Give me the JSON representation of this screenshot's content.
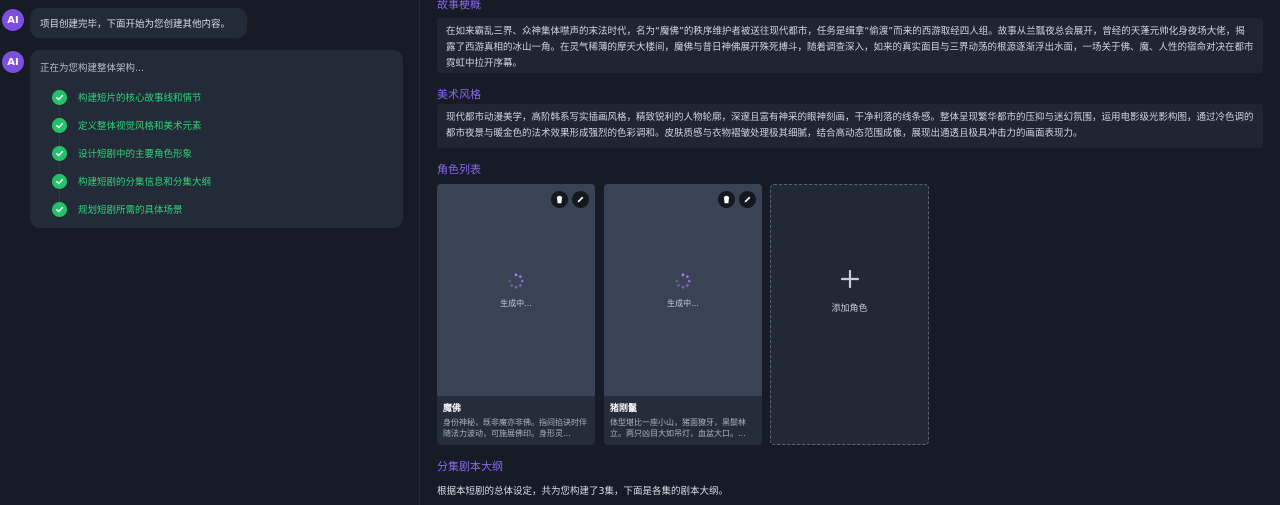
{
  "chat": {
    "avatar_label": "AI",
    "message_1": "项目创建完毕，下面开始为您创建其他内容。",
    "status_text": "正在为您构建整体架构...",
    "steps": [
      {
        "label": "构建短片的核心故事线和情节"
      },
      {
        "label": "定义整体视觉风格和美术元素"
      },
      {
        "label": "设计短剧中的主要角色形象"
      },
      {
        "label": "构建短剧的分集信息和分集大纲"
      },
      {
        "label": "规划短剧所需的具体场景"
      }
    ]
  },
  "content": {
    "story": {
      "title": "故事梗概",
      "text": "在如来霸乱三界、众神集体噤声的末法时代，名为“魔佛”的秩序维护者被送往现代都市，任务是缉拿“偷渡”而来的西游取经四人组。故事从兰瓢夜总会展开，曾经的天蓬元帅化身夜场大佬，揭露了西游真相的冰山一角。在灵气稀薄的摩天大楼间，魔佛与昔日神佛展开殊死搏斗，随着调查深入，如来的真实面目与三界动荡的根源逐渐浮出水面，一场关于佛、魔、人性的宿命对决在都市霓虹中拉开序幕。"
    },
    "art": {
      "title": "美术风格",
      "text": "现代都市动漫美学，高阶韩系写实插画风格，精致锐利的人物轮廓，深邃且富有神采的眼神刻画，干净利落的线条感。整体呈现繁华都市的压抑与迷幻氛围，运用电影级光影构图，通过冷色调的都市夜景与暖金色的法术效果形成强烈的色彩调和。皮肤质感与衣物褶皱处理极其细腻，结合高动态范围成像，展现出通透且极具冲击力的画面表现力。"
    },
    "characters": {
      "title": "角色列表",
      "generating_text": "生成中...",
      "add_label": "添加角色",
      "items": [
        {
          "name": "魔佛",
          "desc": "身份神秘，既非魔亦非佛。指间掐诀时伴随法力波动，可施展佛印。身形灵..."
        },
        {
          "name": "猪刚鬣",
          "desc": "体型堪比一座小山，猪面獠牙，黑鬃林立。两只凶目大如吊灯，血盆大口。..."
        }
      ]
    },
    "episodes": {
      "title": "分集剧本大纲",
      "text": "根据本短剧的总体设定，共为您构建了3集，下面是各集的剧本大纲。"
    }
  },
  "colors": {
    "accent": "#8a66ef",
    "success": "#24c16a",
    "background": "#161b26"
  }
}
